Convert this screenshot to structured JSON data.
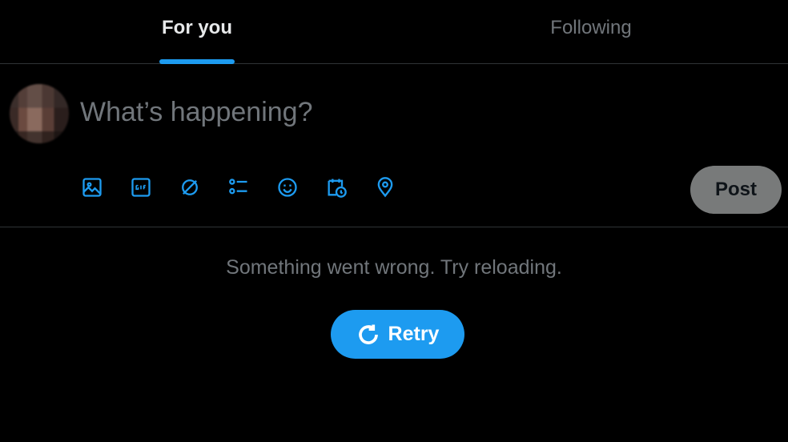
{
  "tabs": [
    {
      "label": "For you",
      "active": true
    },
    {
      "label": "Following",
      "active": false
    }
  ],
  "composer": {
    "placeholder": "What’s happening?",
    "tools": [
      "image-icon",
      "gif-icon",
      "grok-icon",
      "poll-icon",
      "emoji-icon",
      "schedule-icon",
      "location-icon"
    ],
    "post_label": "Post"
  },
  "error": {
    "message": "Something went wrong. Try reloading.",
    "retry_label": "Retry"
  },
  "colors": {
    "accent": "#1d9bf0",
    "background": "#000000",
    "muted_text": "#71767b",
    "divider": "#2f3336"
  }
}
